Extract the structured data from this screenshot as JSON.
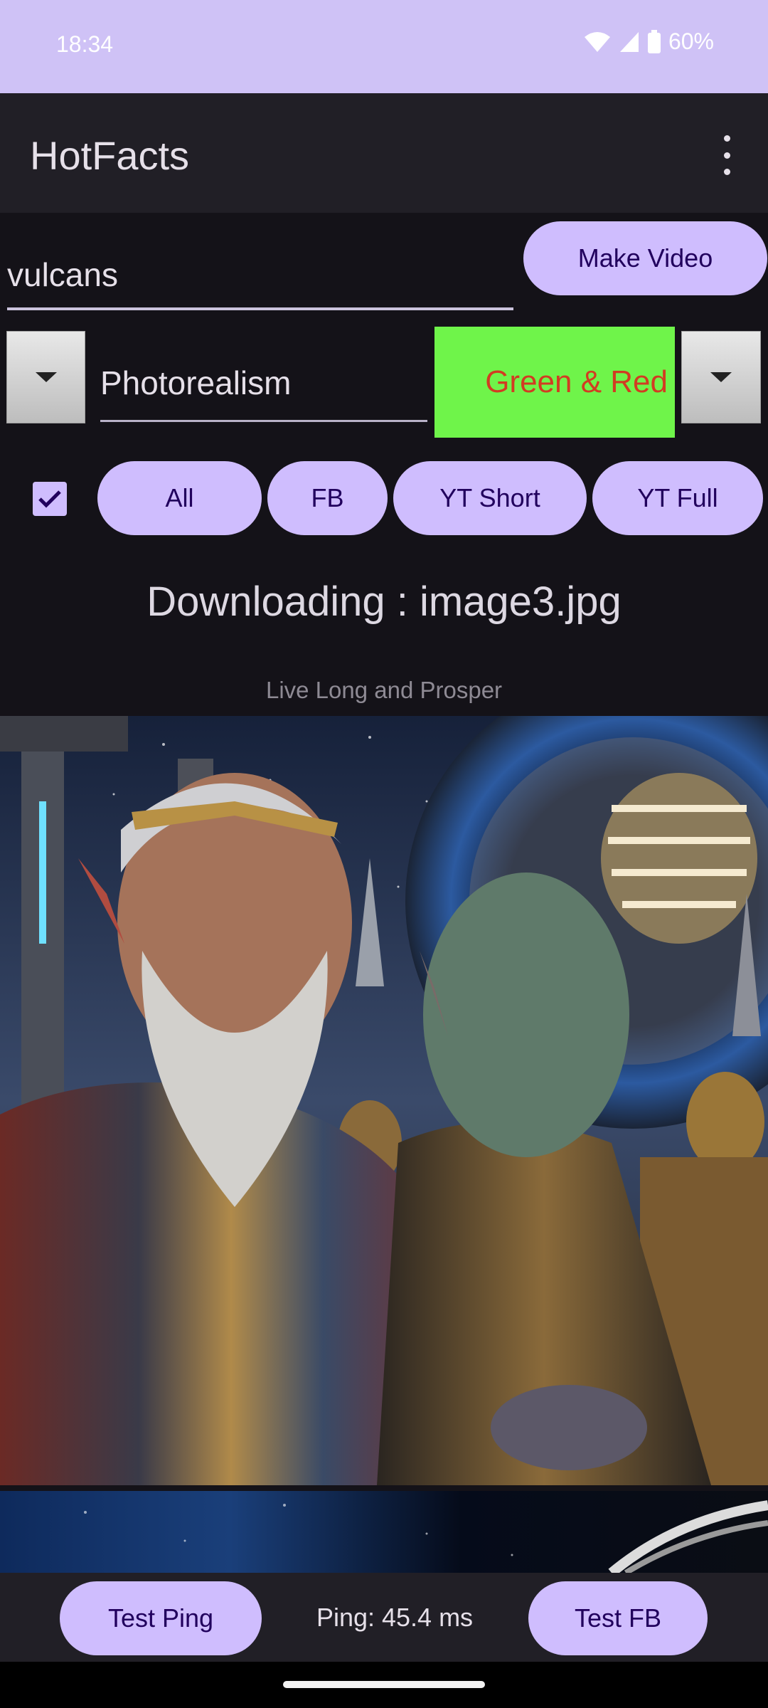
{
  "status_bar": {
    "time": "18:34",
    "battery_pct": "60%",
    "icons": [
      "wifi-icon",
      "signal-icon",
      "battery-icon"
    ]
  },
  "app_bar": {
    "title": "HotFacts",
    "menu_icon": "more-vert-icon"
  },
  "topic_input": {
    "value": "vulcans"
  },
  "make_video_label": "Make Video",
  "style_input": {
    "value": "Photorealism"
  },
  "color_scheme": {
    "label": "Green & Red",
    "bg": "#6ff44a",
    "fg": "#d23c22"
  },
  "checkbox": {
    "checked": true
  },
  "platform_buttons": {
    "all": "All",
    "fb": "FB",
    "yt_short": "YT Short",
    "yt_full": "YT Full"
  },
  "downloading": "Downloading : image3.jpg",
  "caption": "Live Long and Prosper",
  "bottom": {
    "test_ping": "Test Ping",
    "ping": "Ping: 45.4 ms",
    "test_fb": "Test FB"
  },
  "colors": {
    "accent": "#cfbdfe",
    "status_bar": "#cfc2f6",
    "background": "#141218",
    "surface": "#211f26"
  }
}
